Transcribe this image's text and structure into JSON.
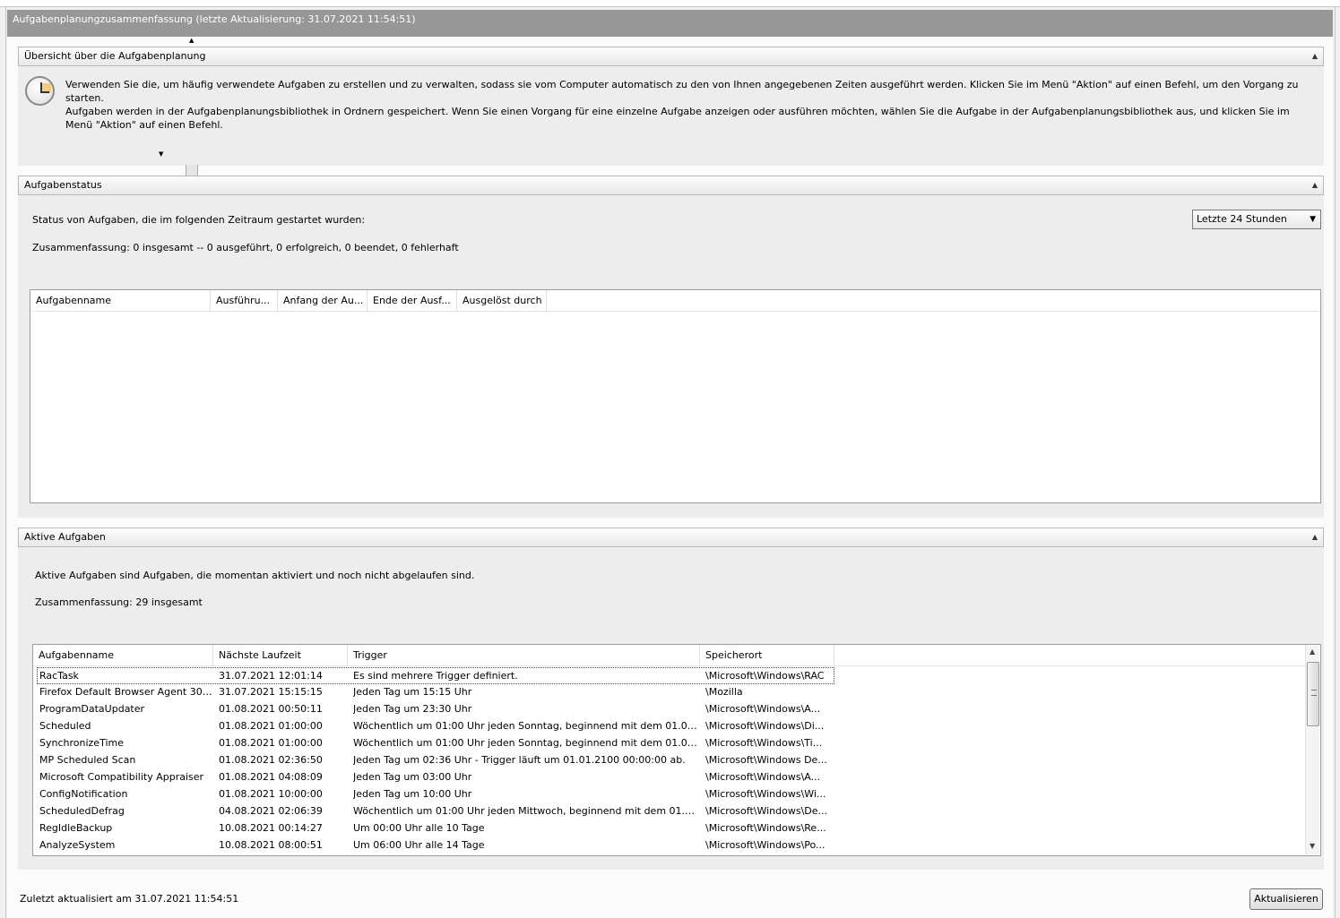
{
  "window": {
    "title": "Aufgabenplanungzusammenfassung (letzte Aktualisierung: 31.07.2021 11:54:51)"
  },
  "overview": {
    "header": "Übersicht über die Aufgabenplanung",
    "paragraph1": "Verwenden Sie die, um häufig verwendete Aufgaben zu erstellen und zu verwalten, sodass sie vom Computer automatisch zu den von Ihnen angegebenen Zeiten ausgeführt werden. Klicken Sie im Menü \"Aktion\" auf einen Befehl, um den Vorgang zu starten.",
    "paragraph2": "Aufgaben werden in der Aufgabenplanungsbibliothek in Ordnern gespeichert. Wenn Sie einen Vorgang für eine einzelne Aufgabe anzeigen oder ausführen möchten, wählen Sie die Aufgabe in der Aufgabenplanungsbibliothek aus, und klicken Sie im Menü \"Aktion\" auf einen Befehl."
  },
  "status": {
    "header": "Aufgabenstatus",
    "label": "Status von Aufgaben, die im folgenden Zeitraum gestartet wurden:",
    "summary": "Zusammenfassung: 0 insgesamt -- 0 ausgeführt, 0 erfolgreich, 0 beendet, 0 fehlerhaft",
    "period": "Letzte 24 Stunden",
    "columns": [
      "Aufgabenname",
      "Ausführu...",
      "Anfang der Au...",
      "Ende der Ausf...",
      "Ausgelöst durch"
    ]
  },
  "active": {
    "header": "Aktive Aufgaben",
    "label": "Aktive Aufgaben sind Aufgaben, die momentan aktiviert und noch nicht abgelaufen sind.",
    "summary": "Zusammenfassung: 29 insgesamt",
    "columns": [
      "Aufgabenname",
      "Nächste Laufzeit",
      "Trigger",
      "Speicherort"
    ],
    "rows": [
      [
        "RacTask",
        "31.07.2021 12:01:14",
        "Es sind mehrere Trigger definiert.",
        "\\Microsoft\\Windows\\RAC"
      ],
      [
        "Firefox Default Browser Agent 3080...",
        "31.07.2021 15:15:15",
        "Jeden Tag um 15:15 Uhr",
        "\\Mozilla"
      ],
      [
        "ProgramDataUpdater",
        "01.08.2021 00:50:11",
        "Jeden Tag um 23:30 Uhr",
        "\\Microsoft\\Windows\\A..."
      ],
      [
        "Scheduled",
        "01.08.2021 01:00:00",
        "Wöchentlich um 01:00 Uhr jeden Sonntag, beginnend mit dem 01.01.2...",
        "\\Microsoft\\Windows\\Di..."
      ],
      [
        "SynchronizeTime",
        "01.08.2021 01:00:00",
        "Wöchentlich um 01:00 Uhr jeden Sonntag, beginnend mit dem 01.01.2...",
        "\\Microsoft\\Windows\\Ti..."
      ],
      [
        "MP Scheduled Scan",
        "01.08.2021 02:36:50",
        "Jeden Tag um 02:36 Uhr - Trigger läuft um 01.01.2100 00:00:00 ab.",
        "\\Microsoft\\Windows De..."
      ],
      [
        "Microsoft Compatibility Appraiser",
        "01.08.2021 04:08:09",
        "Jeden Tag um 03:00 Uhr",
        "\\Microsoft\\Windows\\A..."
      ],
      [
        "ConfigNotification",
        "01.08.2021 10:00:00",
        "Jeden Tag um 10:00 Uhr",
        "\\Microsoft\\Windows\\Wi..."
      ],
      [
        "ScheduledDefrag",
        "04.08.2021 02:06:39",
        "Wöchentlich um 01:00 Uhr jeden Mittwoch, beginnend mit dem 01.01....",
        "\\Microsoft\\Windows\\De..."
      ],
      [
        "RegIdleBackup",
        "10.08.2021 00:14:27",
        "Um 00:00 Uhr alle 10 Tage",
        "\\Microsoft\\Windows\\Re..."
      ],
      [
        "AnalyzeSystem",
        "10.08.2021 08:00:51",
        "Um 06:00 Uhr alle 14 Tage",
        "\\Microsoft\\Windows\\Po..."
      ]
    ]
  },
  "footer": {
    "last_updated": "Zuletzt aktualisiert am 31.07.2021 11:54:51",
    "refresh_button": "Aktualisieren"
  },
  "icons": {
    "overview": "clock-icon",
    "collapse": "collapse-arrow-icon",
    "dropdown": "chevron-down-icon"
  }
}
